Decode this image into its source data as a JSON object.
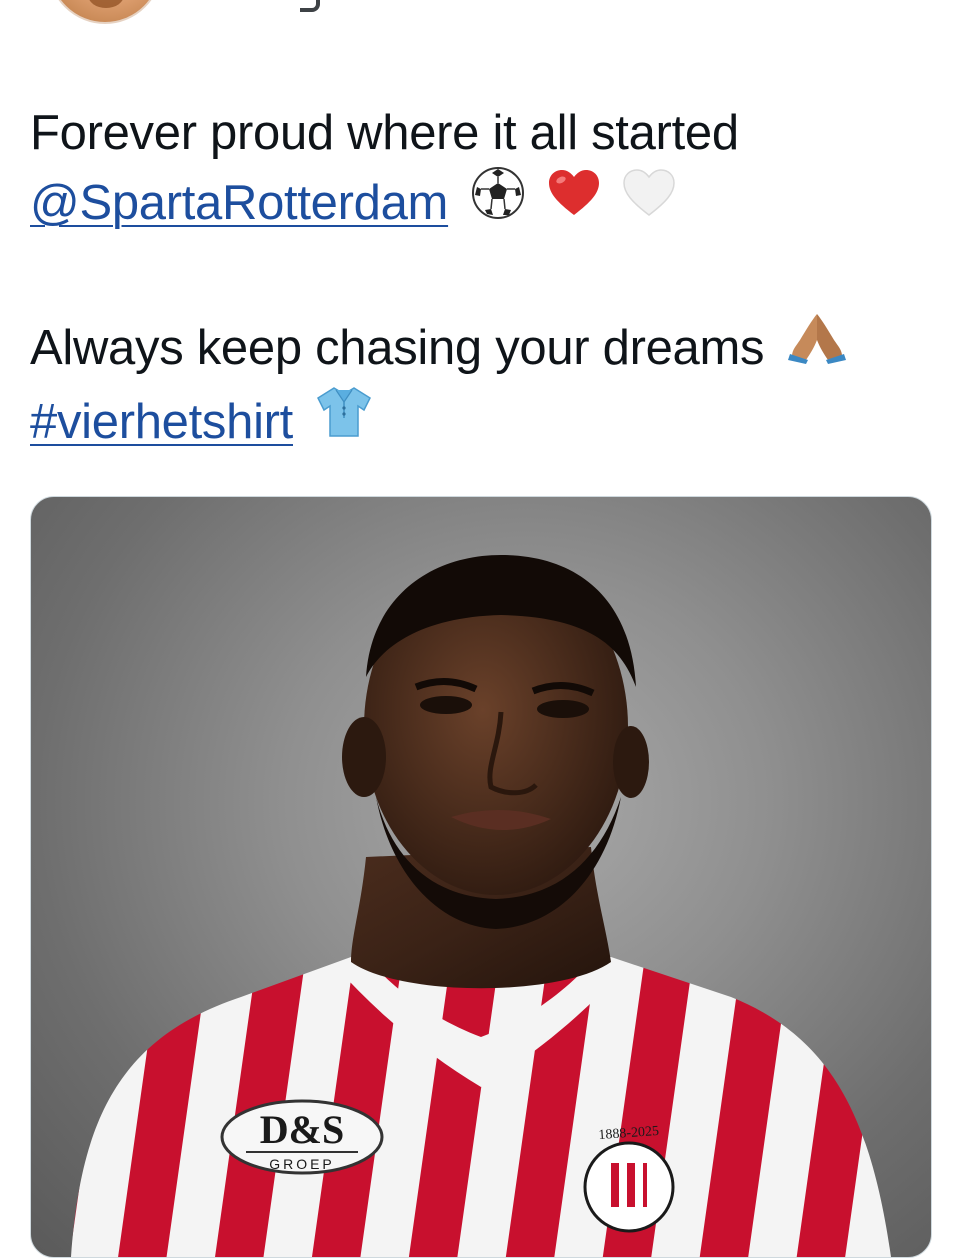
{
  "tweet": {
    "line1": "Forever proud where it all started",
    "mention": "@SpartaRotterdam",
    "line3": "Always keep chasing your dreams",
    "hashtag": "#vierhetshirt",
    "emojis_line2": [
      "soccer-ball-icon",
      "red-heart-icon",
      "white-heart-icon"
    ],
    "emoji_line3": "folded-hands-icon",
    "emoji_line4": "shirt-icon"
  },
  "media": {
    "sponsor_main": "D&S",
    "sponsor_sub": "GROEP",
    "crest_years": "1888-2025",
    "colors": {
      "jersey_red": "#c8102e",
      "jersey_white": "#f4f4f4",
      "background_gray": "#8f8f8f"
    }
  },
  "colors": {
    "link": "#1d4e9e",
    "text": "#0f1419"
  }
}
